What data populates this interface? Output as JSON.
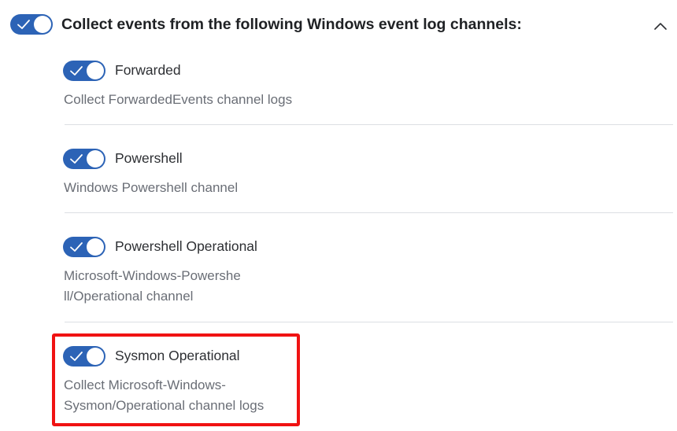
{
  "colors": {
    "toggle_on": "#2c63b6",
    "highlight": "#f01212"
  },
  "header": {
    "toggle_state": "on",
    "title": "Collect events from the following Windows event log channels:",
    "collapse_icon": "chevron-up-icon"
  },
  "channels": [
    {
      "label": "Forwarded",
      "description": "Collect ForwardedEvents channel logs",
      "toggle_state": "on"
    },
    {
      "label": "Powershell",
      "description": "Windows Powershell channel",
      "toggle_state": "on"
    },
    {
      "label": "Powershell Operational",
      "description": "Microsoft-Windows-Powershell/Operational channel",
      "toggle_state": "on"
    },
    {
      "label": "Sysmon Operational",
      "description": "Collect Microsoft-Windows-Sysmon/Operational channel logs",
      "toggle_state": "on",
      "highlighted": true
    }
  ]
}
